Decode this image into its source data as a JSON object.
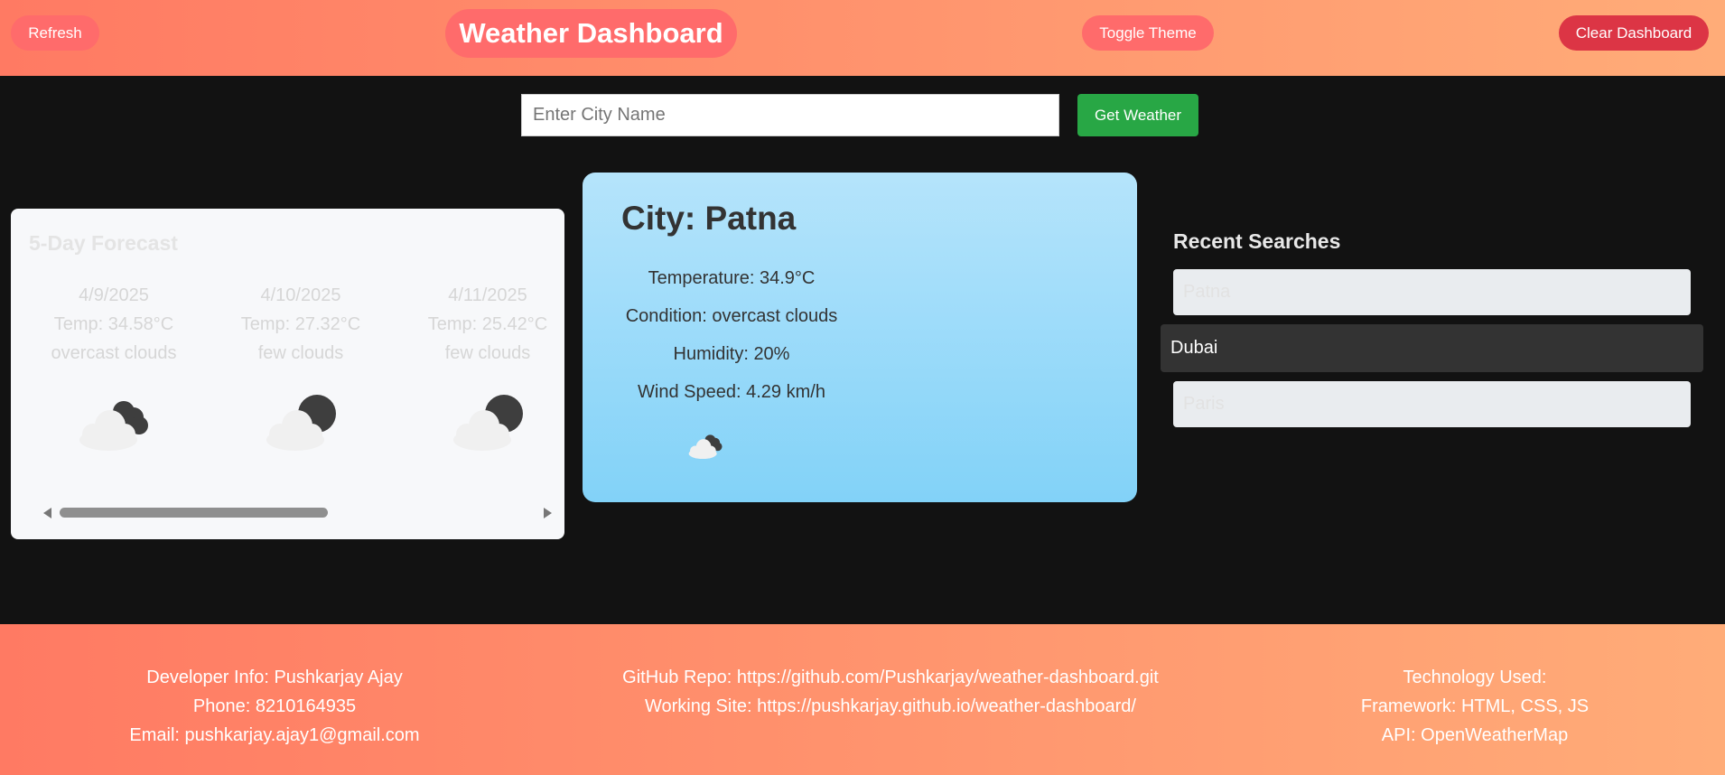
{
  "header": {
    "refresh_label": "Refresh",
    "title": "Weather Dashboard",
    "toggle_theme_label": "Toggle Theme",
    "clear_label": "Clear Dashboard"
  },
  "search": {
    "placeholder": "Enter City Name",
    "value": "",
    "button_label": "Get Weather"
  },
  "forecast": {
    "title": "5-Day Forecast",
    "days": [
      {
        "date": "4/9/2025",
        "temp": "Temp: 34.58°C",
        "condition": "overcast clouds",
        "icon": "overcast-clouds-icon"
      },
      {
        "date": "4/10/2025",
        "temp": "Temp: 27.32°C",
        "condition": "few clouds",
        "icon": "few-clouds-night-icon"
      },
      {
        "date": "4/11/2025",
        "temp": "Temp: 25.42°C",
        "condition": "few clouds",
        "icon": "few-clouds-night-icon"
      }
    ]
  },
  "current": {
    "city": "City: Patna",
    "temperature": "Temperature: 34.9°C",
    "condition": "Condition: overcast clouds",
    "humidity": "Humidity: 20%",
    "wind": "Wind Speed: 4.29 km/h",
    "icon": "overcast-clouds-icon"
  },
  "recent": {
    "title": "Recent Searches",
    "items": [
      "Patna",
      "Dubai",
      "Paris"
    ]
  },
  "footer": {
    "developer": "Developer Info: Pushkarjay Ajay",
    "phone": "Phone: 8210164935",
    "email": "Email: pushkarjay.ajay1@gmail.com",
    "github": "GitHub Repo: https://github.com/Pushkarjay/weather-dashboard.git",
    "site": "Working Site: https://pushkarjay.github.io/weather-dashboard/",
    "tech_title": "Technology Used:",
    "framework": "Framework: HTML, CSS, JS",
    "api": "API: OpenWeatherMap"
  },
  "colors": {
    "header_gradient_start": "#ff7a63",
    "header_gradient_end": "#ffac78",
    "pill": "#ff6b6b",
    "danger": "#dc3545",
    "success": "#28a745",
    "background": "#121212"
  }
}
